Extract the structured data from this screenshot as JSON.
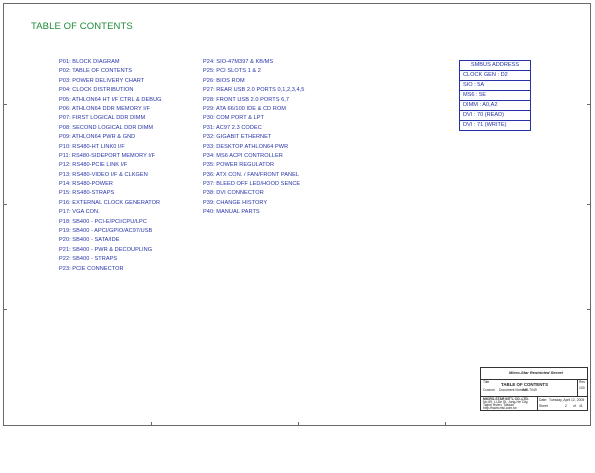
{
  "title": "TABLE OF CONTENTS",
  "toc_left": [
    "P01: BLOCK DIAGRAM",
    "P02: TABLE OF CONTENTS",
    "P03: POWER DELIVERY CHART",
    "P04: CLOCK DISTRIBUTION",
    "P05: ATHLON64 HT I/F CTRL & DEBUG",
    "P06: ATHLON64 DDR MEMORY I/F",
    "P07: FIRST LOGICAL DDR DIMM",
    "P08: SECOND LOGICAL DDR DIMM",
    "P09: ATHLON64 PWR & GND",
    "P10: RS480-HT LINK0 I/F",
    "P11: RS480-SIDEPORT MEMORY I/F",
    "P12: RS480-PCIE LINK I/F",
    "P13: RS480-VIDEO I/F & CLKGEN",
    "P14: RS480-POWER",
    "P15: RS480-STRAPS",
    "P16: EXTERNAL CLOCK GENERATOR",
    "P17: VGA CON.",
    "P18: SB400 - PCI-E/PCI/CPU/LPC",
    "P19: SB400 - APCI/GPIO/AC97/USB",
    "P20: SB400 - SATA/IDE",
    "P21: SB400 - PWR & DECOUPLING",
    "P22: SB400 - STRAPS",
    "P23: PCIE CONNECTOR"
  ],
  "toc_right": [
    "P24: SIO-47M397 & KB/MS",
    "P25: PCI SLOTS 1 & 2",
    "P26: BIOS ROM",
    "P27: REAR USB 2.0 PORTS 0,1,2,3,4,5",
    "P28: FRONT USB 2.0 PORTS 6,7",
    "P29: ATA 66/100 IDE & CD ROM",
    "P30: COM PORT & LPT",
    "P31: AC97 2.3 CODEC",
    "P32: GIGABIT ETHERNET",
    "P33: DESKTOP ATHLON64 PWR",
    "P34: MS6 ACPI CONTROLLER",
    "P35: POWER REGULATOR",
    "P36: ATX CON. / FAN/FRONT PANEL",
    "P37: BLEED OFF LED/HOOD SENCE",
    "P38: DVI CONNECTOR",
    "P39: CHANGE HISTORY",
    "P40: MANUAL PARTS"
  ],
  "smbus": {
    "header": "SMBUS ADDRESS",
    "rows": [
      "CLOCK GEN : D2",
      "SIO : 5A",
      "MS6 : 5E",
      "DIMM : A0,A2",
      "DVI : 70 (READ)",
      "DVI : 71 (WRITE)"
    ]
  },
  "title_block": {
    "company": "Micro-Star Restricted Secret",
    "title_label": "Title",
    "sheet_title": "TABLE OF CONTENTS",
    "size_label": "Size",
    "size_value": "Custom",
    "doc_label": "Document Number",
    "doc_value": "MS-7049",
    "rev_label": "Rev",
    "rev_value": "100",
    "address_1": "MICRO-STAR INT'L CO.,LTD.",
    "address_2": "No 69, Li-De St, Jung-He City,",
    "address_3": "Taipei Hsien, Taiwan",
    "address_4": "http://www.msi.com.tw",
    "date_label": "Date:",
    "date_value": "Tuesday, April 12, 2005",
    "sheet_label": "Sheet",
    "sheet_value": "2",
    "of_label": "of",
    "of_value": "41"
  },
  "colors": {
    "title": "#1f8a3a",
    "text": "#2633a8",
    "border": "#6a6a6a"
  }
}
